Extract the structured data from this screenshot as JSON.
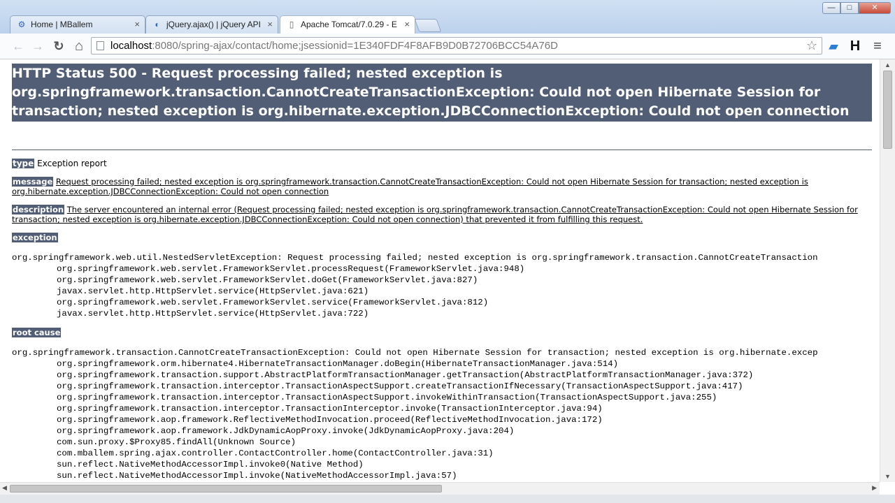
{
  "browser": {
    "tabs": [
      {
        "label": "Home | MBallem",
        "icon": "gear-icon",
        "close": "×"
      },
      {
        "label": "jQuery.ajax() | jQuery API",
        "icon": "jquery-icon",
        "close": "×"
      },
      {
        "label": "Apache Tomcat/7.0.29 - E",
        "icon": "page-icon",
        "close": "×"
      }
    ],
    "window_controls": {
      "minimize": "—",
      "maximize": "□",
      "close": "✕"
    },
    "address": {
      "host": "localhost",
      "rest": ":8080/spring-ajax/contact/home;jsessionid=1E340FDF4F8AFB9D0B72706BCC54A76D"
    },
    "toolbar_icons": {
      "back": "←",
      "forward": "→",
      "reload": "↻",
      "home": "⌂",
      "star": "☆",
      "extension": "▰",
      "h_extension": "H",
      "menu": "≡"
    }
  },
  "page": {
    "title": "HTTP Status 500 - Request processing failed; nested exception is org.springframework.transaction.CannotCreateTransactionException: Could not open Hibernate Session for transaction; nested exception is org.hibernate.exception.JDBCConnectionException: Could not open connection",
    "type_label": "type",
    "type_value": "Exception report",
    "message_label": "message",
    "message_value": "Request processing failed; nested exception is org.springframework.transaction.CannotCreateTransactionException: Could not open Hibernate Session for transaction; nested exception is org.hibernate.exception.JDBCConnectionException: Could not open connection",
    "description_label": "description",
    "description_value": "The server encountered an internal error (Request processing failed; nested exception is org.springframework.transaction.CannotCreateTransactionException: Could not open Hibernate Session for transaction; nested exception is org.hibernate.exception.JDBCConnectionException: Could not open connection) that prevented it from fulfilling this request.",
    "exception_label": "exception",
    "exception_trace": [
      "org.springframework.web.util.NestedServletException: Request processing failed; nested exception is org.springframework.transaction.CannotCreateTransaction",
      "org.springframework.web.servlet.FrameworkServlet.processRequest(FrameworkServlet.java:948)",
      "org.springframework.web.servlet.FrameworkServlet.doGet(FrameworkServlet.java:827)",
      "javax.servlet.http.HttpServlet.service(HttpServlet.java:621)",
      "org.springframework.web.servlet.FrameworkServlet.service(FrameworkServlet.java:812)",
      "javax.servlet.http.HttpServlet.service(HttpServlet.java:722)"
    ],
    "root_cause_label": "root cause",
    "root_cause_trace": [
      "org.springframework.transaction.CannotCreateTransactionException: Could not open Hibernate Session for transaction; nested exception is org.hibernate.excep",
      "org.springframework.orm.hibernate4.HibernateTransactionManager.doBegin(HibernateTransactionManager.java:514)",
      "org.springframework.transaction.support.AbstractPlatformTransactionManager.getTransaction(AbstractPlatformTransactionManager.java:372)",
      "org.springframework.transaction.interceptor.TransactionAspectSupport.createTransactionIfNecessary(TransactionAspectSupport.java:417)",
      "org.springframework.transaction.interceptor.TransactionAspectSupport.invokeWithinTransaction(TransactionAspectSupport.java:255)",
      "org.springframework.transaction.interceptor.TransactionInterceptor.invoke(TransactionInterceptor.java:94)",
      "org.springframework.aop.framework.ReflectiveMethodInvocation.proceed(ReflectiveMethodInvocation.java:172)",
      "org.springframework.aop.framework.JdkDynamicAopProxy.invoke(JdkDynamicAopProxy.java:204)",
      "com.sun.proxy.$Proxy85.findAll(Unknown Source)",
      "com.mballem.spring.ajax.controller.ContactController.home(ContactController.java:31)",
      "sun.reflect.NativeMethodAccessorImpl.invoke0(Native Method)",
      "sun.reflect.NativeMethodAccessorImpl.invoke(NativeMethodAccessorImpl.java:57)"
    ]
  },
  "colors": {
    "tomcat_header": "#525d76",
    "chrome_frame": "#bcd2ec"
  }
}
